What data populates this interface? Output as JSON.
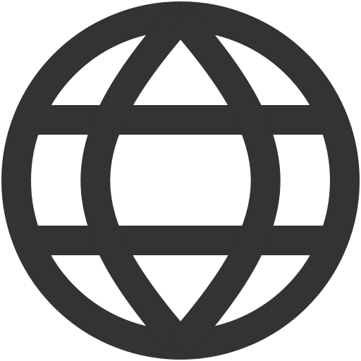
{
  "icon": {
    "name": "globe-icon",
    "color": "#333333",
    "background": "#ffffff"
  }
}
